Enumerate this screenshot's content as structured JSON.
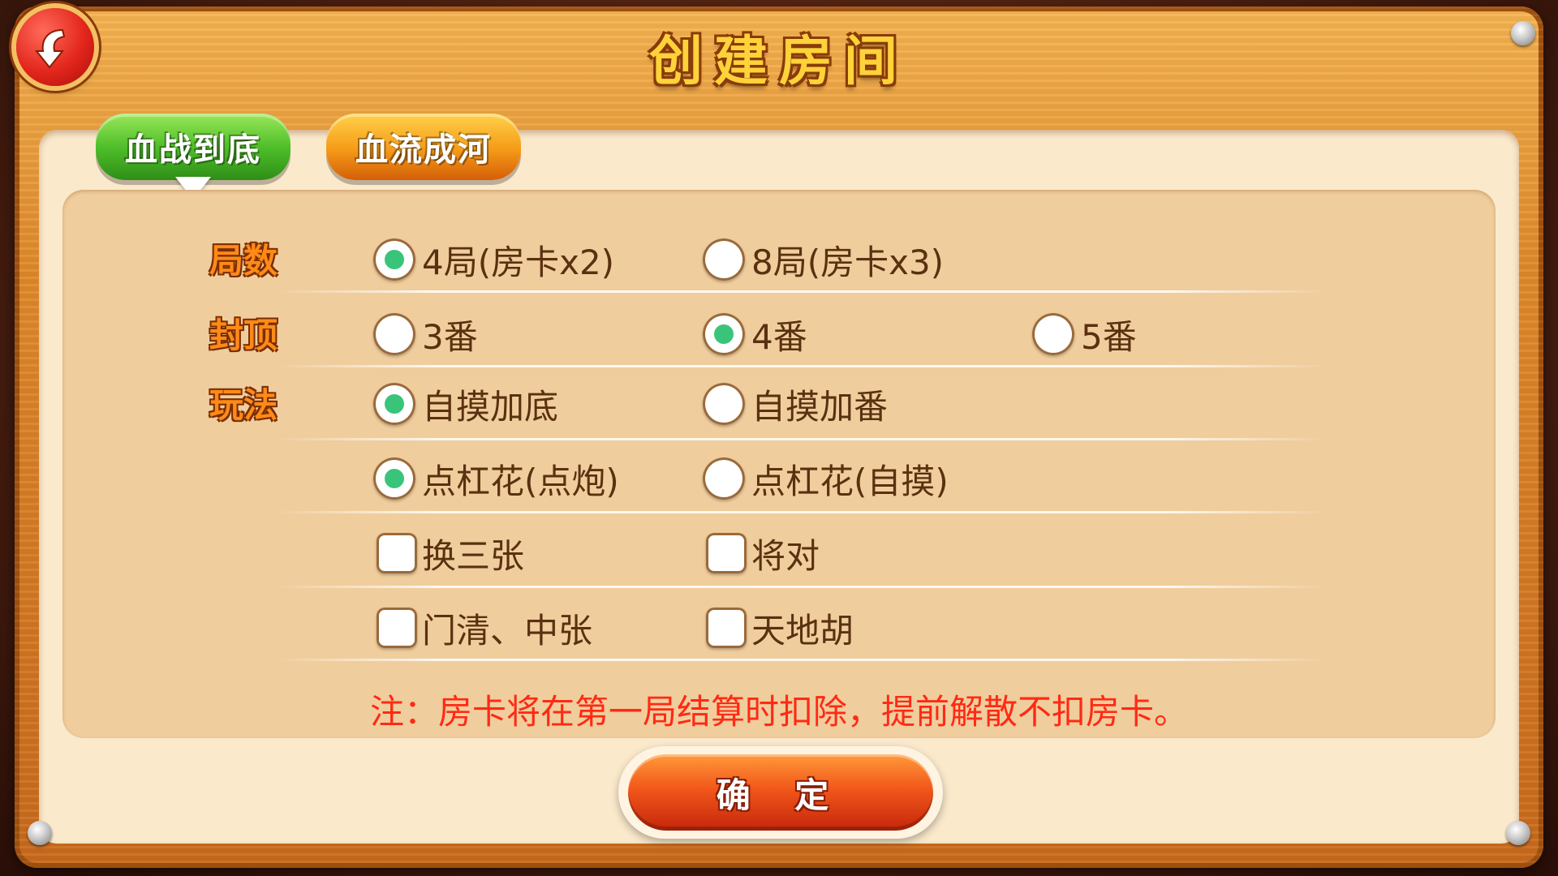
{
  "window": {
    "title": "创建房间"
  },
  "tabs": [
    {
      "label": "血战到底",
      "active": true
    },
    {
      "label": "血流成河",
      "active": false
    }
  ],
  "rows": {
    "rounds": {
      "label": "局数",
      "options": [
        {
          "label": "4局(房卡x2)",
          "selected": true
        },
        {
          "label": "8局(房卡x3)",
          "selected": false
        }
      ]
    },
    "cap": {
      "label": "封顶",
      "options": [
        {
          "label": "3番",
          "selected": false
        },
        {
          "label": "4番",
          "selected": true
        },
        {
          "label": "5番",
          "selected": false
        }
      ]
    },
    "play": {
      "label": "玩法",
      "selfdraw": [
        {
          "label": "自摸加底",
          "selected": true
        },
        {
          "label": "自摸加番",
          "selected": false
        }
      ],
      "kong": [
        {
          "label": "点杠花(点炮)",
          "selected": true
        },
        {
          "label": "点杠花(自摸)",
          "selected": false
        }
      ],
      "extras": [
        {
          "label": "换三张",
          "checked": false
        },
        {
          "label": "将对",
          "checked": false
        },
        {
          "label": "门清、中张",
          "checked": false
        },
        {
          "label": "天地胡",
          "checked": false
        }
      ]
    }
  },
  "note": "注：房卡将在第一局结算时扣除，提前解散不扣房卡。",
  "confirm_label": "确 定",
  "colors": {
    "accent_green": "#39c47a",
    "note_red": "#ff2a14",
    "label_orange": "#ff8a18"
  }
}
